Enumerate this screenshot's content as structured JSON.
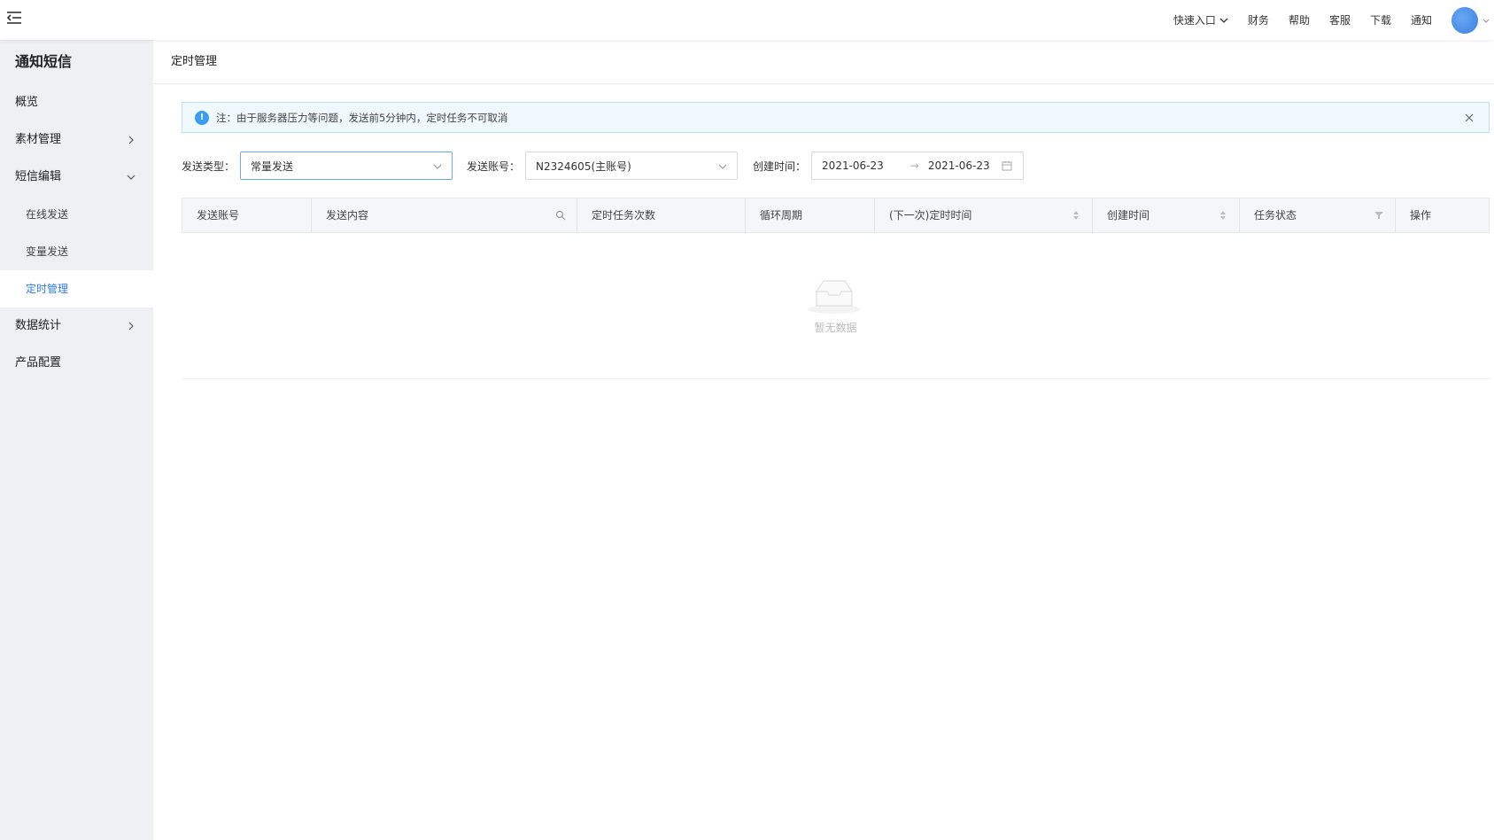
{
  "topbar": {
    "quick_entry": "快速入口",
    "nav": [
      "财务",
      "帮助",
      "客服",
      "下载",
      "通知"
    ]
  },
  "sidebar": {
    "title": "通知短信",
    "items": [
      {
        "label": "概览"
      },
      {
        "label": "素材管理",
        "arrow": "chevron-right-icon"
      },
      {
        "label": "短信编辑",
        "arrow": "chevron-down-icon"
      },
      {
        "label": "在线发送"
      },
      {
        "label": "变量发送"
      },
      {
        "label": "定时管理",
        "active": true
      },
      {
        "label": "数据统计",
        "arrow": "chevron-right-icon"
      },
      {
        "label": "产品配置"
      }
    ]
  },
  "page": {
    "title": "定时管理"
  },
  "alert": {
    "text": "注：由于服务器压力等问题，发送前5分钟内，定时任务不可取消"
  },
  "filters": {
    "send_type_label": "发送类型：",
    "send_type_value": "常量发送",
    "account_label": "发送账号：",
    "account_value": "N2324605(主账号)",
    "created_label": "创建时间：",
    "date_start": "2021-06-23",
    "date_end": "2021-06-23"
  },
  "table": {
    "columns": [
      "发送账号",
      "发送内容",
      "定时任务次数",
      "循环周期",
      "(下一次)定时时间",
      "创建时间",
      "任务状态",
      "操作"
    ],
    "empty_text": "暂无数据"
  },
  "colors": {
    "accent": "#2f7bf1",
    "sidebar_bg": "#eef0f3",
    "alert_bg": "#eef8fd",
    "info_icon": "#3a9df0"
  }
}
